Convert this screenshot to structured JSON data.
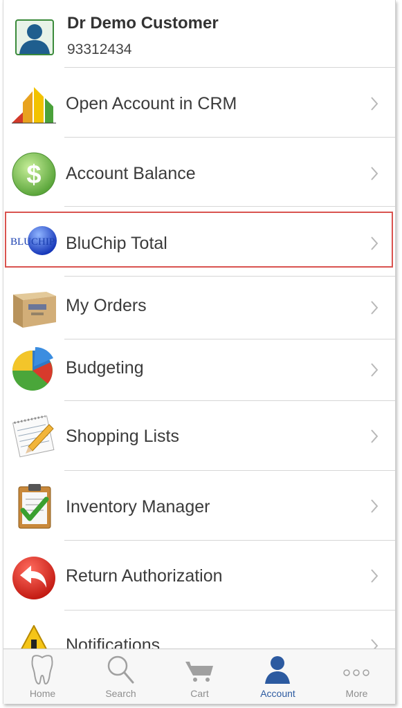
{
  "customer": {
    "name": "Dr Demo Customer",
    "number": "93312434"
  },
  "menu": [
    {
      "label": "Open Account in CRM",
      "icon": "crm-chart-icon"
    },
    {
      "label": "Account Balance",
      "icon": "dollar-coin-icon"
    },
    {
      "label": "BluChip Total",
      "icon": "bluchip-logo-icon",
      "icon_text": "BLUCHIP",
      "highlighted": true
    },
    {
      "label": "My Orders",
      "icon": "box-icon"
    },
    {
      "label": "Budgeting",
      "icon": "pie-chart-icon"
    },
    {
      "label": "Shopping Lists",
      "icon": "notepad-pencil-icon"
    },
    {
      "label": "Inventory Manager",
      "icon": "clipboard-check-icon"
    },
    {
      "label": "Return Authorization",
      "icon": "return-arrow-icon"
    },
    {
      "label": "Notifications",
      "icon": "warning-icon"
    }
  ],
  "tabs": [
    {
      "label": "Home",
      "icon": "tooth-icon"
    },
    {
      "label": "Search",
      "icon": "search-icon"
    },
    {
      "label": "Cart",
      "icon": "cart-icon"
    },
    {
      "label": "Account",
      "icon": "person-icon",
      "active": true
    },
    {
      "label": "More",
      "icon": "more-dots-icon"
    }
  ],
  "colors": {
    "accent": "#2c5aa0",
    "highlight_border": "#d9534f",
    "inactive_tab": "#8e8e8e"
  }
}
